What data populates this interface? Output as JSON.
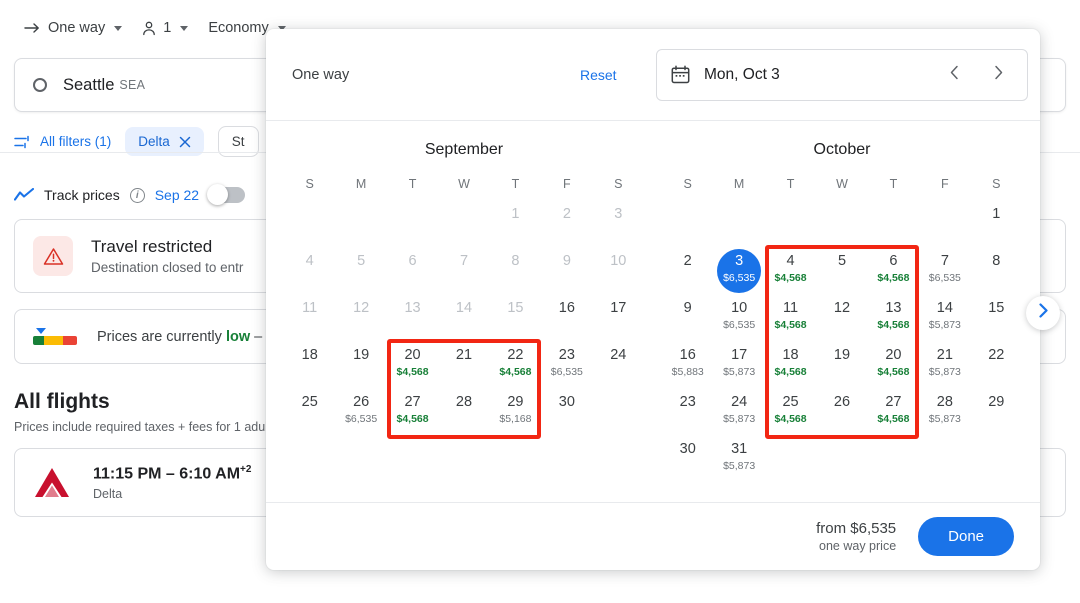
{
  "topbar": {
    "trip_type": "One way",
    "passengers": "1",
    "cabin": "Economy",
    "trip_icon": "arrow-right-icon",
    "passenger_icon": "person-icon"
  },
  "search": {
    "origin": "Seattle",
    "origin_code": "SEA",
    "origin_icon": "circle-dot-icon"
  },
  "filters": {
    "all_filters_label": "All filters (1)",
    "all_filters_icon": "tune-icon",
    "chips": [
      {
        "label": "Delta",
        "removable": true
      },
      {
        "label": "St",
        "removable": false
      }
    ]
  },
  "track_prices": {
    "label": "Track prices",
    "icon": "trend-line-icon",
    "info_icon": "info-icon",
    "date": "Sep 22",
    "toggle_on": false
  },
  "travel_card": {
    "icon": "warning-triangle-icon",
    "title": "Travel restricted",
    "subtitle": "Destination closed to entr"
  },
  "price_card": {
    "icon": "price-gauge-icon",
    "text_before": "Prices are currently ",
    "highlight": "low",
    "text_after": " –"
  },
  "all_flights": {
    "heading": "All flights",
    "subheading": "Prices include required taxes + fees for 1 adul",
    "flights": [
      {
        "time": "11:15 PM – 6:10 AM",
        "day_offset": "+2",
        "airline": "Delta",
        "logo": "delta-logo-icon"
      }
    ]
  },
  "next_page_button": {
    "icon": "chevron-right-icon"
  },
  "calendar": {
    "trip_type": "One way",
    "reset_label": "Reset",
    "date_field": {
      "icon": "calendar-icon",
      "value": "Mon, Oct 3",
      "prev_icon": "chevron-left-icon",
      "next_icon": "chevron-right-icon"
    },
    "weekdays": [
      "S",
      "M",
      "T",
      "W",
      "T",
      "F",
      "S"
    ],
    "months": [
      {
        "name": "September",
        "lead_blanks": 4,
        "days": [
          {
            "n": 1,
            "price": null,
            "dim": true,
            "cheap": false
          },
          {
            "n": 2,
            "price": null,
            "dim": true,
            "cheap": false
          },
          {
            "n": 3,
            "price": null,
            "dim": true,
            "cheap": false
          },
          {
            "n": 4,
            "price": null,
            "dim": true,
            "cheap": false
          },
          {
            "n": 5,
            "price": null,
            "dim": true,
            "cheap": false
          },
          {
            "n": 6,
            "price": null,
            "dim": true,
            "cheap": false
          },
          {
            "n": 7,
            "price": null,
            "dim": true,
            "cheap": false
          },
          {
            "n": 8,
            "price": null,
            "dim": true,
            "cheap": false
          },
          {
            "n": 9,
            "price": null,
            "dim": true,
            "cheap": false
          },
          {
            "n": 10,
            "price": null,
            "dim": true,
            "cheap": false
          },
          {
            "n": 11,
            "price": null,
            "dim": true,
            "cheap": false
          },
          {
            "n": 12,
            "price": null,
            "dim": true,
            "cheap": false
          },
          {
            "n": 13,
            "price": null,
            "dim": true,
            "cheap": false
          },
          {
            "n": 14,
            "price": null,
            "dim": true,
            "cheap": false
          },
          {
            "n": 15,
            "price": null,
            "dim": true,
            "cheap": false
          },
          {
            "n": 16,
            "price": null,
            "dim": false,
            "cheap": false
          },
          {
            "n": 17,
            "price": null,
            "dim": false,
            "cheap": false
          },
          {
            "n": 18,
            "price": null,
            "dim": false,
            "cheap": false
          },
          {
            "n": 19,
            "price": null,
            "dim": false,
            "cheap": false
          },
          {
            "n": 20,
            "price": "$4,568",
            "dim": false,
            "cheap": true
          },
          {
            "n": 21,
            "price": null,
            "dim": false,
            "cheap": false
          },
          {
            "n": 22,
            "price": "$4,568",
            "dim": false,
            "cheap": true
          },
          {
            "n": 23,
            "price": "$6,535",
            "dim": false,
            "cheap": false
          },
          {
            "n": 24,
            "price": null,
            "dim": false,
            "cheap": false
          },
          {
            "n": 25,
            "price": null,
            "dim": false,
            "cheap": false
          },
          {
            "n": 26,
            "price": "$6,535",
            "dim": false,
            "cheap": false
          },
          {
            "n": 27,
            "price": "$4,568",
            "dim": false,
            "cheap": true
          },
          {
            "n": 28,
            "price": null,
            "dim": false,
            "cheap": false
          },
          {
            "n": 29,
            "price": "$5,168",
            "dim": false,
            "cheap": false
          },
          {
            "n": 30,
            "price": null,
            "dim": false,
            "cheap": false
          }
        ],
        "highlight": {
          "col_start": 2,
          "col_end": 4,
          "row_start": 3,
          "row_end": 4
        }
      },
      {
        "name": "October",
        "lead_blanks": 6,
        "days": [
          {
            "n": 1,
            "price": null,
            "dim": false,
            "cheap": false
          },
          {
            "n": 2,
            "price": null,
            "dim": false,
            "cheap": false
          },
          {
            "n": 3,
            "price": "$6,535",
            "dim": false,
            "cheap": false,
            "selected": true
          },
          {
            "n": 4,
            "price": "$4,568",
            "dim": false,
            "cheap": true
          },
          {
            "n": 5,
            "price": null,
            "dim": false,
            "cheap": false
          },
          {
            "n": 6,
            "price": "$4,568",
            "dim": false,
            "cheap": true
          },
          {
            "n": 7,
            "price": "$6,535",
            "dim": false,
            "cheap": false
          },
          {
            "n": 8,
            "price": null,
            "dim": false,
            "cheap": false
          },
          {
            "n": 9,
            "price": null,
            "dim": false,
            "cheap": false
          },
          {
            "n": 10,
            "price": "$6,535",
            "dim": false,
            "cheap": false
          },
          {
            "n": 11,
            "price": "$4,568",
            "dim": false,
            "cheap": true
          },
          {
            "n": 12,
            "price": null,
            "dim": false,
            "cheap": false
          },
          {
            "n": 13,
            "price": "$4,568",
            "dim": false,
            "cheap": true
          },
          {
            "n": 14,
            "price": "$5,873",
            "dim": false,
            "cheap": false
          },
          {
            "n": 15,
            "price": null,
            "dim": false,
            "cheap": false
          },
          {
            "n": 16,
            "price": "$5,883",
            "dim": false,
            "cheap": false
          },
          {
            "n": 17,
            "price": "$5,873",
            "dim": false,
            "cheap": false
          },
          {
            "n": 18,
            "price": "$4,568",
            "dim": false,
            "cheap": true
          },
          {
            "n": 19,
            "price": null,
            "dim": false,
            "cheap": false
          },
          {
            "n": 20,
            "price": "$4,568",
            "dim": false,
            "cheap": true
          },
          {
            "n": 21,
            "price": "$5,873",
            "dim": false,
            "cheap": false
          },
          {
            "n": 22,
            "price": null,
            "dim": false,
            "cheap": false
          },
          {
            "n": 23,
            "price": null,
            "dim": false,
            "cheap": false
          },
          {
            "n": 24,
            "price": "$5,873",
            "dim": false,
            "cheap": false
          },
          {
            "n": 25,
            "price": "$4,568",
            "dim": false,
            "cheap": true
          },
          {
            "n": 26,
            "price": null,
            "dim": false,
            "cheap": false
          },
          {
            "n": 27,
            "price": "$4,568",
            "dim": false,
            "cheap": true
          },
          {
            "n": 28,
            "price": "$5,873",
            "dim": false,
            "cheap": false
          },
          {
            "n": 29,
            "price": null,
            "dim": false,
            "cheap": false
          },
          {
            "n": 30,
            "price": null,
            "dim": false,
            "cheap": false
          },
          {
            "n": 31,
            "price": "$5,873",
            "dim": false,
            "cheap": false
          }
        ],
        "highlight": {
          "col_start": 2,
          "col_end": 4,
          "row_start": 1,
          "row_end": 4
        }
      }
    ],
    "footer": {
      "from_price": "from $6,535",
      "price_note": "one way price",
      "done_label": "Done"
    }
  },
  "colors": {
    "accent_blue": "#1a73e8",
    "cheap_green": "#188038",
    "highlight_red": "#f22613",
    "chip_bg": "#e8f0fe"
  }
}
